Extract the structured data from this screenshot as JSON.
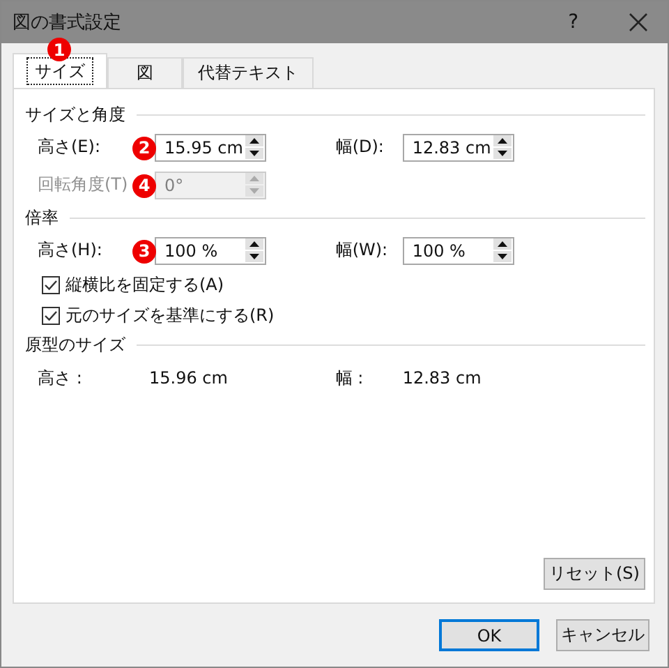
{
  "window": {
    "title": "図の書式設定",
    "help": "?"
  },
  "tabs": [
    {
      "label": "サイズ",
      "selected": true,
      "badge": "1"
    },
    {
      "label": "図",
      "selected": false
    },
    {
      "label": "代替テキスト",
      "selected": false
    }
  ],
  "sections": [
    {
      "title": "サイズと角度",
      "rows": [
        {
          "kind": "fields",
          "fields": [
            {
              "label": "高さ(E):",
              "value": "15.95 cm",
              "disabled": false,
              "badge": "2"
            },
            {
              "label": "幅(D):",
              "value": "12.83 cm",
              "disabled": false
            }
          ]
        },
        {
          "kind": "fields",
          "fields": [
            {
              "label": "回転角度(T)",
              "value": "0°",
              "disabled": true,
              "badge": "4"
            }
          ]
        }
      ]
    },
    {
      "title": "倍率",
      "rows": [
        {
          "kind": "fields",
          "fields": [
            {
              "label": "高さ(H):",
              "value": "100 %",
              "disabled": false,
              "badge": "3"
            },
            {
              "label": "幅(W):",
              "value": "100 %",
              "disabled": false
            }
          ]
        },
        {
          "kind": "checkbox",
          "label": "縦横比を固定する(A)",
          "checked": true
        },
        {
          "kind": "checkbox",
          "label": "元のサイズを基準にする(R)",
          "checked": true
        }
      ]
    },
    {
      "title": "原型のサイズ",
      "rows": [
        {
          "kind": "info",
          "items": [
            {
              "label": "高さ :",
              "value": "15.96 cm"
            },
            {
              "label": "幅 :",
              "value": "12.83 cm"
            }
          ]
        }
      ]
    }
  ],
  "reset_button": {
    "label": "リセット(S)"
  },
  "buttons": [
    {
      "label": "OK",
      "selected": true
    },
    {
      "label": "キャンセル",
      "selected": false
    }
  ]
}
